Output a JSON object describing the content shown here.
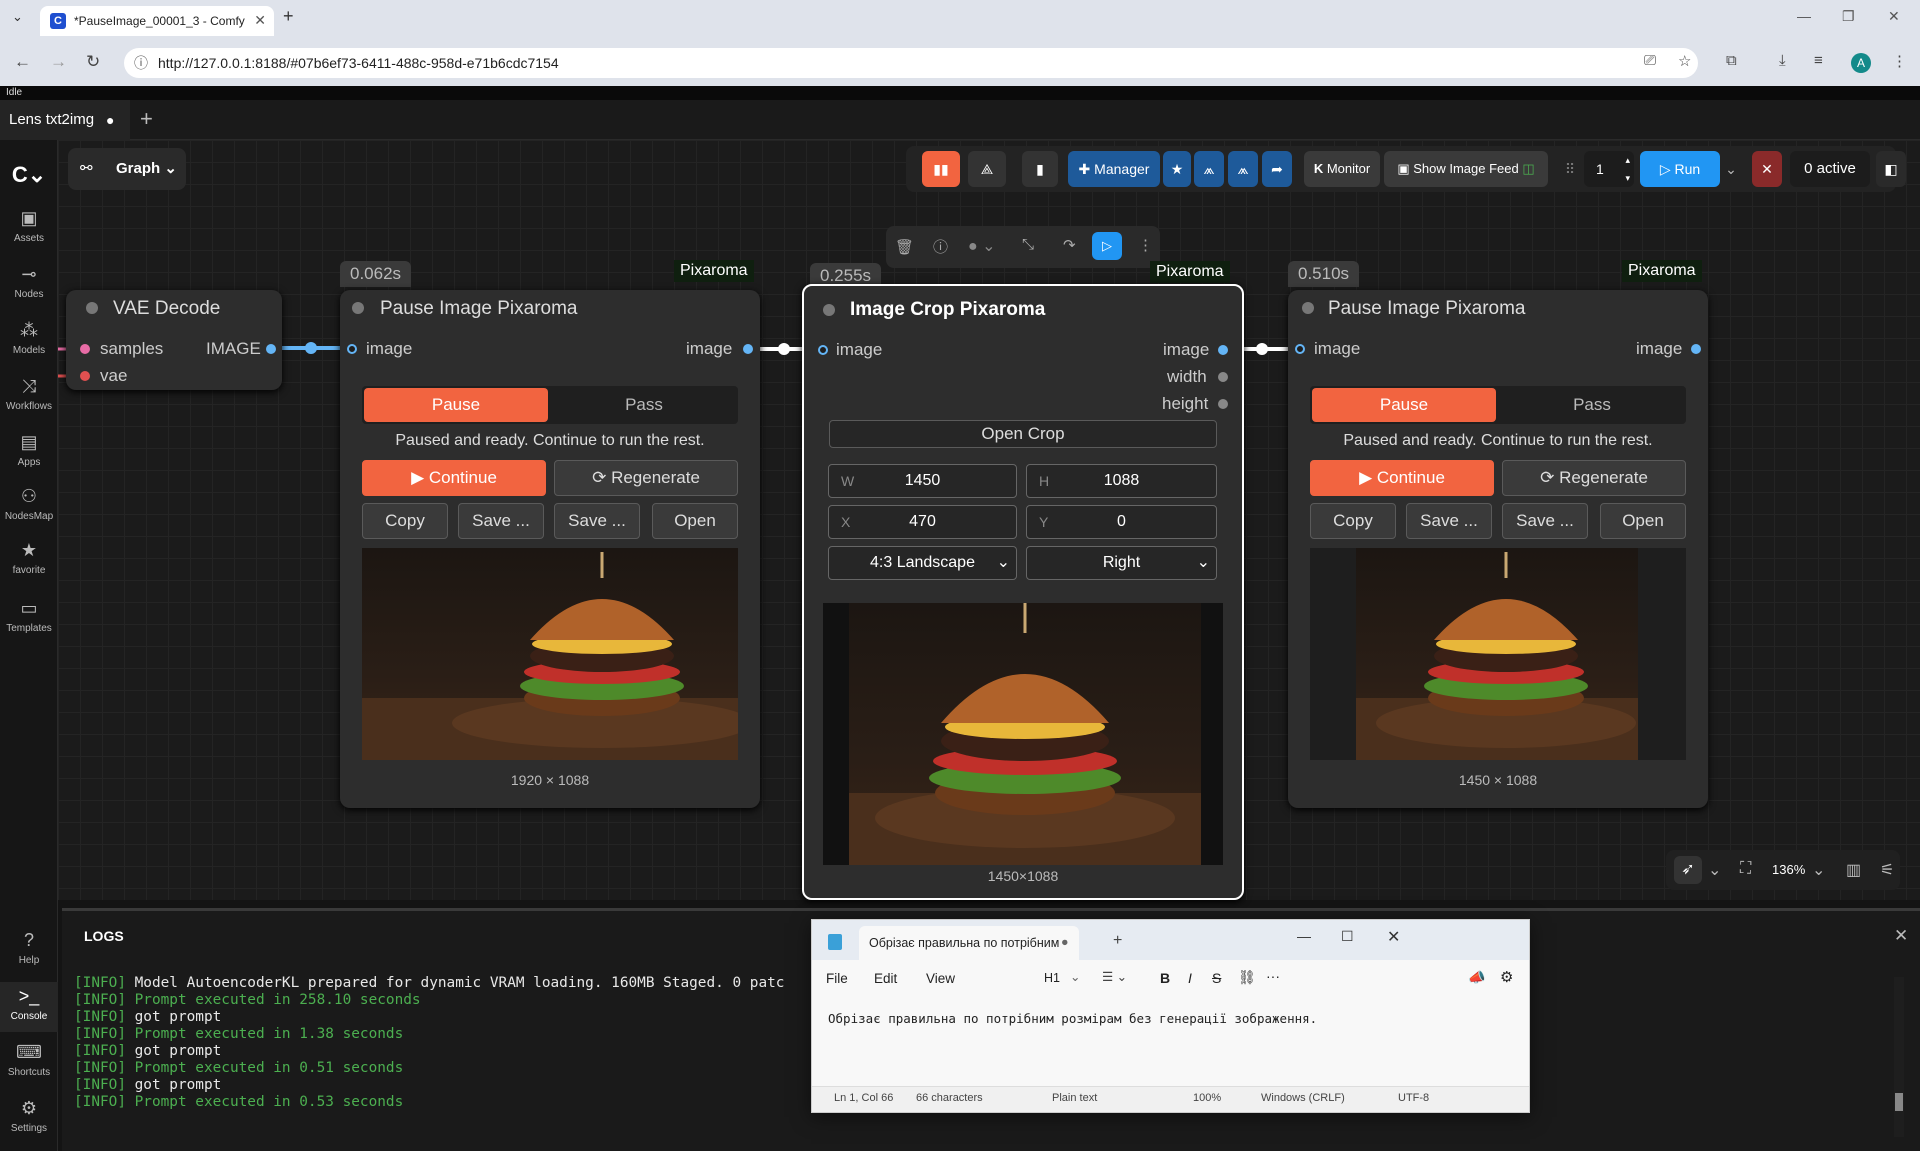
{
  "browser": {
    "tab_title": "*PauseImage_00001_3 - Comfy",
    "url": "http://127.0.0.1:8188/#07b6ef73-6411-488c-958d-e71b6cdc7154",
    "avatar": "A"
  },
  "status": "Idle",
  "workflow_tab": "Lens txt2img",
  "graph_button": "Graph",
  "toolbar": {
    "manager": "Manager",
    "monitor": "Monitor",
    "show_image_feed": "Show Image Feed",
    "queue_count": "1",
    "run": "Run",
    "active": "0 active"
  },
  "sidebar": [
    "Assets",
    "Nodes",
    "Models",
    "Workflows",
    "Apps",
    "NodesMap",
    "favorite",
    "Templates",
    "Help",
    "Console",
    "Shortcuts",
    "Settings"
  ],
  "vae": {
    "title": "VAE Decode",
    "in1": "samples",
    "in2": "vae",
    "out": "IMAGE"
  },
  "pause1": {
    "time": "0.062s",
    "badge": "Pixaroma",
    "title": "Pause Image Pixaroma",
    "in": "image",
    "out": "image",
    "pause": "Pause",
    "pass": "Pass",
    "msg": "Paused and ready. Continue to run the rest.",
    "continue": "Continue",
    "regenerate": "Regenerate",
    "copy": "Copy",
    "save1": "Save ...",
    "save2": "Save ...",
    "open": "Open",
    "size": "1920 × 1088"
  },
  "crop": {
    "time": "0.255s",
    "badge": "Pixaroma",
    "title": "Image Crop Pixaroma",
    "in": "image",
    "out1": "image",
    "out2": "width",
    "out3": "height",
    "open_crop": "Open Crop",
    "w_label": "W",
    "w": "1450",
    "h_label": "H",
    "h": "1088",
    "x_label": "X",
    "x": "470",
    "y_label": "Y",
    "y": "0",
    "ratio": "4:3 Landscape",
    "anchor": "Right",
    "size": "1450×1088"
  },
  "pause2": {
    "time": "0.510s",
    "badge": "Pixaroma",
    "title": "Pause Image Pixaroma",
    "in": "image",
    "out": "image",
    "pause": "Pause",
    "pass": "Pass",
    "msg": "Paused and ready. Continue to run the rest.",
    "continue": "Continue",
    "regenerate": "Regenerate",
    "copy": "Copy",
    "save1": "Save ...",
    "save2": "Save ...",
    "open": "Open",
    "size": "1450 × 1088"
  },
  "zoom": "136%",
  "logs": {
    "title": "LOGS",
    "lines": [
      {
        "tag": "[INFO]",
        "text": " Model AutoencoderKL prepared for dynamic VRAM loading. 160MB Staged. 0 patc",
        "green": false
      },
      {
        "tag": "[INFO]",
        "text": " Prompt executed in 258.10 seconds",
        "green": true
      },
      {
        "tag": "[INFO]",
        "text": " got prompt",
        "green": false
      },
      {
        "tag": "[INFO]",
        "text": " Prompt executed in 1.38 seconds",
        "green": true
      },
      {
        "tag": "[INFO]",
        "text": " got prompt",
        "green": false
      },
      {
        "tag": "[INFO]",
        "text": " Prompt executed in 0.51 seconds",
        "green": true
      },
      {
        "tag": "[INFO]",
        "text": " got prompt",
        "green": false
      },
      {
        "tag": "[INFO]",
        "text": " Prompt executed in 0.53 seconds",
        "green": true
      }
    ]
  },
  "notepad": {
    "tab": "Обрізає правильна по потрібним",
    "menu_file": "File",
    "menu_edit": "Edit",
    "menu_view": "View",
    "heading": "H1",
    "text": "Обрізає правильна по потрібним розмірам без генерації зображення.",
    "pos": "Ln 1, Col 66",
    "chars": "66 characters",
    "format": "Plain text",
    "zoom": "100%",
    "eol": "Windows (CRLF)",
    "enc": "UTF-8"
  }
}
